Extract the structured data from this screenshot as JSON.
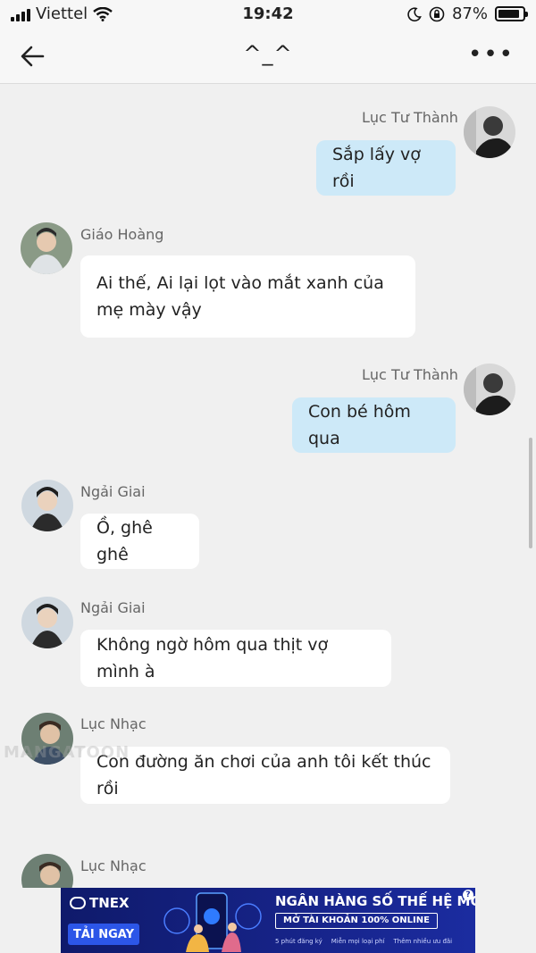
{
  "status_bar": {
    "carrier": "Viettel",
    "time": "19:42",
    "battery": "87%",
    "battery_level": 0.87
  },
  "header": {
    "title": "^_^"
  },
  "messages": [
    {
      "sender": "Lục Tư Thành",
      "text": "Sắp lấy vợ rồi",
      "side": "right"
    },
    {
      "sender": "Giáo Hoàng",
      "text": "Ai thế, Ai lại lọt vào mắt xanh của mẹ mày vậy",
      "side": "left"
    },
    {
      "sender": "Lục Tư Thành",
      "text": "Con bé hôm qua",
      "side": "right"
    },
    {
      "sender": "Ngải Giai",
      "text": "Ồ, ghê ghê",
      "side": "left"
    },
    {
      "sender": "Ngải Giai",
      "text": "Không ngờ hôm qua thịt vợ mình à",
      "side": "left"
    },
    {
      "sender": "Lục Nhạc",
      "text": "Con đường ăn chơi của anh tôi kết thúc rồi",
      "side": "left"
    },
    {
      "sender": "Lục Nhạc",
      "text": "",
      "side": "left"
    }
  ],
  "watermark": "MANGATOON",
  "ad": {
    "brand": "TNEX",
    "cta": "TẢI NGAY",
    "headline": "NGÂN HÀNG SỐ THẾ HỆ MỚI",
    "subheadline": "MỞ TÀI KHOẢN 100% ONLINE",
    "features": [
      "5 phút đăng ký",
      "Miễn mọi loại phí",
      "Thêm nhiều ưu đãi"
    ],
    "info": "?"
  },
  "colors": {
    "outgoing_bubble": "#cde9f8",
    "incoming_bubble": "#ffffff",
    "background": "#f0f0f0",
    "ad_background": "#17248a"
  }
}
